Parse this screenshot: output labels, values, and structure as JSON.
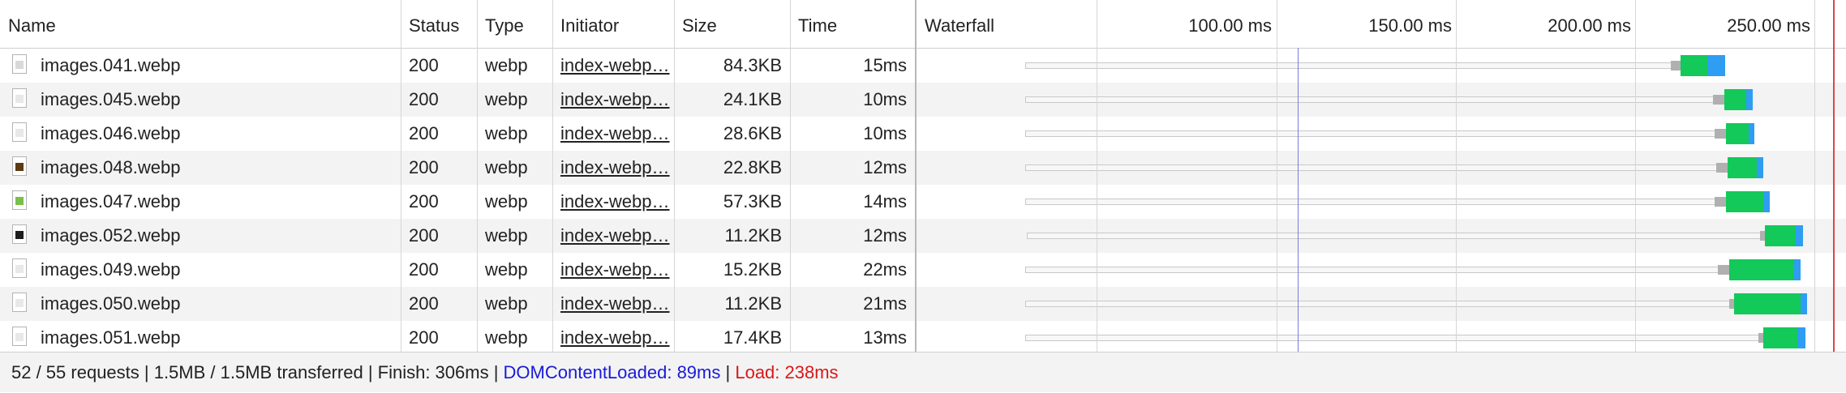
{
  "columns": {
    "name": "Name",
    "status": "Status",
    "type": "Type",
    "initiator": "Initiator",
    "size": "Size",
    "time": "Time",
    "waterfall": "Waterfall"
  },
  "waterfall": {
    "ticks": [
      "100.00 ms",
      "150.00 ms",
      "200.00 ms",
      "250.00 ms"
    ],
    "colors": {
      "queue": "#b0b0b0",
      "waiting": "#13c959",
      "download": "#2e9df2",
      "domcontentloaded_line": "#7b7bdc",
      "load_line": "#e04646"
    }
  },
  "rows": [
    {
      "name": "images.041.webp",
      "status": "200",
      "type": "webp",
      "initiator": "index-webp…",
      "size": "84.3KB",
      "time": "15ms",
      "icon": "grid-thumbnail-icon"
    },
    {
      "name": "images.045.webp",
      "status": "200",
      "type": "webp",
      "initiator": "index-webp…",
      "size": "24.1KB",
      "time": "10ms",
      "icon": "image-thumbnail-icon"
    },
    {
      "name": "images.046.webp",
      "status": "200",
      "type": "webp",
      "initiator": "index-webp…",
      "size": "28.6KB",
      "time": "10ms",
      "icon": "image-thumbnail-icon"
    },
    {
      "name": "images.048.webp",
      "status": "200",
      "type": "webp",
      "initiator": "index-webp…",
      "size": "22.8KB",
      "time": "12ms",
      "icon": "dark-image-thumbnail-icon"
    },
    {
      "name": "images.047.webp",
      "status": "200",
      "type": "webp",
      "initiator": "index-webp…",
      "size": "57.3KB",
      "time": "14ms",
      "icon": "green-image-thumbnail-icon"
    },
    {
      "name": "images.052.webp",
      "status": "200",
      "type": "webp",
      "initiator": "index-webp…",
      "size": "11.2KB",
      "time": "12ms",
      "icon": "black-image-thumbnail-icon"
    },
    {
      "name": "images.049.webp",
      "status": "200",
      "type": "webp",
      "initiator": "index-webp…",
      "size": "15.2KB",
      "time": "22ms",
      "icon": "image-thumbnail-icon"
    },
    {
      "name": "images.050.webp",
      "status": "200",
      "type": "webp",
      "initiator": "index-webp…",
      "size": "11.2KB",
      "time": "21ms",
      "icon": "image-thumbnail-icon"
    },
    {
      "name": "images.051.webp",
      "status": "200",
      "type": "webp",
      "initiator": "index-webp…",
      "size": "17.4KB",
      "time": "13ms",
      "icon": "image-thumbnail-icon"
    }
  ],
  "footer": {
    "summary": "52 / 55 requests | 1.5MB / 1.5MB transferred | Finish: 306ms |",
    "dom": "DOMContentLoaded: 89ms",
    "sep": "|",
    "load": "Load: 238ms"
  }
}
